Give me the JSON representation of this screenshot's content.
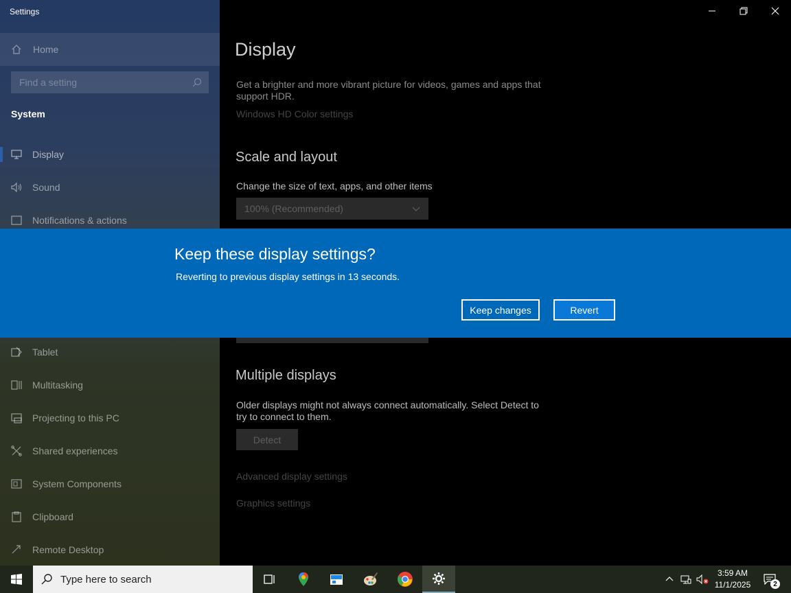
{
  "window": {
    "title": "Settings"
  },
  "sidebar": {
    "home_label": "Home",
    "search_placeholder": "Find a setting",
    "section_title": "System",
    "items": [
      {
        "label": "Display",
        "icon": "monitor-icon"
      },
      {
        "label": "Sound",
        "icon": "speaker-icon"
      },
      {
        "label": "Notifications & actions",
        "icon": "notification-icon"
      },
      {
        "label": "Tablet",
        "icon": "tablet-icon"
      },
      {
        "label": "Multitasking",
        "icon": "multitasking-icon"
      },
      {
        "label": "Projecting to this PC",
        "icon": "projector-icon"
      },
      {
        "label": "Shared experiences",
        "icon": "shared-icon"
      },
      {
        "label": "System Components",
        "icon": "components-icon"
      },
      {
        "label": "Clipboard",
        "icon": "clipboard-icon"
      },
      {
        "label": "Remote Desktop",
        "icon": "remote-desktop-icon"
      }
    ]
  },
  "main": {
    "title": "Display",
    "hdr_text": "Get a brighter and more vibrant picture for videos, games and apps that support HDR.",
    "hdr_link": "Windows HD Color settings",
    "scale_title": "Scale and layout",
    "scale_label": "Change the size of text, apps, and other items",
    "scale_value": "100% (Recommended)",
    "multi_title": "Multiple displays",
    "multi_text": "Older displays might not always connect automatically. Select Detect to try to connect to them.",
    "detect_label": "Detect",
    "advanced_link": "Advanced display settings",
    "graphics_link": "Graphics settings"
  },
  "banner": {
    "title": "Keep these display settings?",
    "subtitle": "Reverting to previous display settings in 13 seconds.",
    "keep_label": "Keep changes",
    "revert_label": "Revert",
    "color": "#0068b8"
  },
  "taskbar": {
    "search_placeholder": "Type here to search",
    "apps": [
      "task-view-icon",
      "maps-icon",
      "file-manager-icon",
      "paint-icon",
      "chrome-icon",
      "settings-icon"
    ],
    "time": "3:59 AM",
    "date": "11/1/2025",
    "notification_count": "2"
  }
}
